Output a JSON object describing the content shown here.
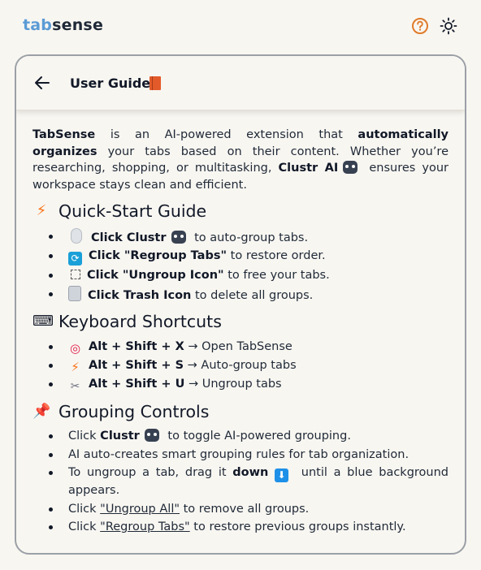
{
  "app": {
    "name_part1": "tab",
    "name_part2": "sense"
  },
  "header": {
    "title": "User Guide"
  },
  "intro": {
    "brand": "TabSense",
    "text1": " is an AI-powered extension that ",
    "bold1": "automatically organizes",
    "text2": " your tabs based on their content. Whether you’re researching, shopping, or multitasking, ",
    "bold2": "Clustr AI",
    "text3": " ensures your workspace stays clean and efficient."
  },
  "quickstart": {
    "title": "Quick-Start Guide",
    "items": [
      {
        "bold": "Click Clustr",
        "text": " to auto-group tabs."
      },
      {
        "bold": "Click \"Regroup Tabs\"",
        "text": " to restore order."
      },
      {
        "bold": "Click \"Ungroup Icon\"",
        "text": " to free your tabs."
      },
      {
        "bold": "Click Trash Icon",
        "text": " to delete all groups."
      }
    ]
  },
  "shortcuts": {
    "title": "Keyboard Shortcuts",
    "items": [
      {
        "bold": "Alt + Shift + X",
        "text": " → Open TabSense"
      },
      {
        "bold": "Alt + Shift + S",
        "text": " → Auto-group tabs"
      },
      {
        "bold": "Alt + Shift + U",
        "text": " → Ungroup tabs"
      }
    ]
  },
  "controls": {
    "title": "Grouping Controls",
    "item1_pre": "Click ",
    "item1_bold": "Clustr",
    "item1_post": " to toggle AI-powered grouping.",
    "item2": "AI auto-creates smart grouping rules for tab organization.",
    "item3_pre": "To ungroup a tab, drag it ",
    "item3_bold": "down",
    "item3_post": " until a blue background appears.",
    "item4_pre": "Click ",
    "item4_link": "\"Ungroup All\"",
    "item4_post": " to remove all groups.",
    "item5_pre": "Click ",
    "item5_link": "\"Regroup Tabs\"",
    "item5_post": " to restore previous groups instantly."
  },
  "icons": {
    "help": "help-circle-icon",
    "theme": "sun-icon",
    "back": "arrow-left-icon",
    "accent_orange": "#e07b2a",
    "brand_blue": "#5b9bd5"
  }
}
